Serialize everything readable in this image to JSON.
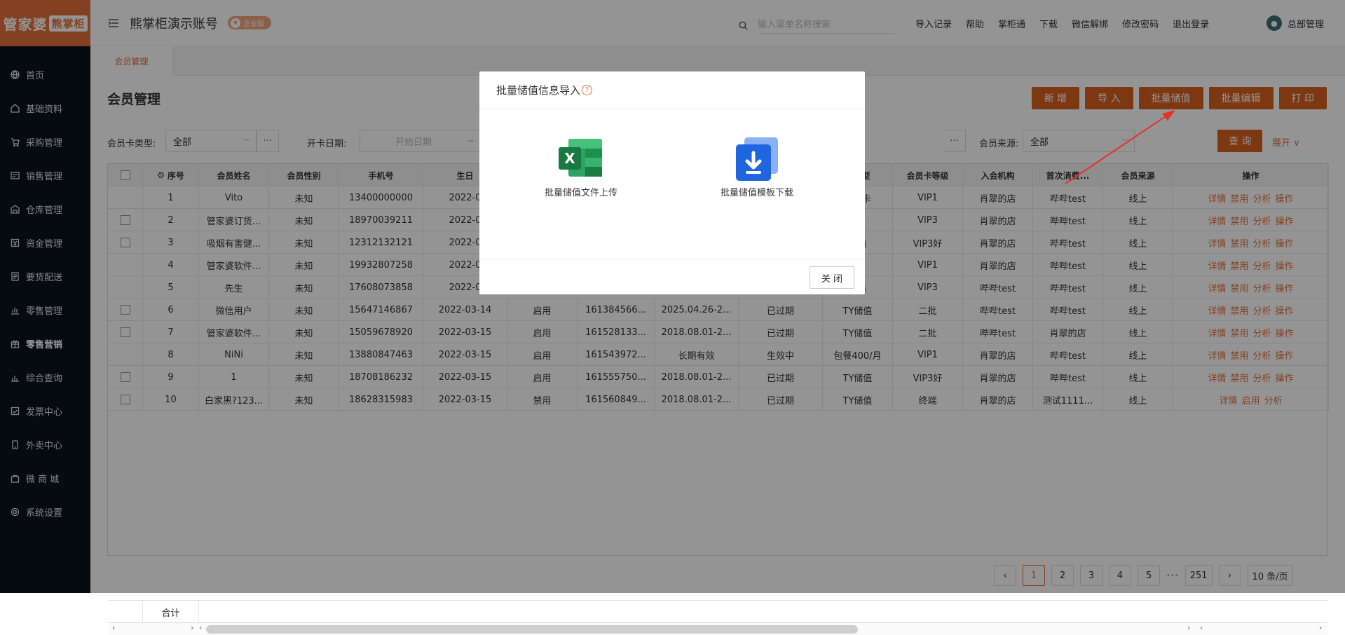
{
  "brand": {
    "logo_main": "管家婆",
    "logo_sub": "熊掌柜"
  },
  "sidebar": {
    "items": [
      {
        "label": "首页",
        "icon": "globe-icon"
      },
      {
        "label": "基础资料",
        "icon": "home-icon"
      },
      {
        "label": "采购管理",
        "icon": "cart-icon"
      },
      {
        "label": "销售管理",
        "icon": "sales-icon"
      },
      {
        "label": "仓库管理",
        "icon": "warehouse-icon"
      },
      {
        "label": "资金管理",
        "icon": "money-icon"
      },
      {
        "label": "要货配送",
        "icon": "document-icon"
      },
      {
        "label": "零售管理",
        "icon": "chart-icon"
      },
      {
        "label": "零售营销",
        "icon": "gift-icon"
      },
      {
        "label": "综合查询",
        "icon": "bar-chart-icon"
      },
      {
        "label": "发票中心",
        "icon": "invoice-icon"
      },
      {
        "label": "外卖中心",
        "icon": "delivery-icon"
      },
      {
        "label": "微 商 城",
        "icon": "shop-icon"
      },
      {
        "label": "系统设置",
        "icon": "gear-icon"
      }
    ]
  },
  "header": {
    "account": "熊掌柜演示账号",
    "edition": "企业版",
    "search_placeholder": "输入菜单名称搜索",
    "links": [
      "导入记录",
      "帮助",
      "掌柜通",
      "下载",
      "微信解绑",
      "修改密码",
      "退出登录"
    ],
    "user": "总部管理"
  },
  "tab": "会员管理",
  "page": {
    "title": "会员管理",
    "actions": [
      "新 增",
      "导 入",
      "批量储值",
      "批量编辑",
      "打 印"
    ]
  },
  "filters": {
    "card_type_label": "会员卡类型:",
    "card_type_value": "全部",
    "open_date_label": "开卡日期:",
    "date_start": "开始日期",
    "date_sep": "~",
    "source_label": "会员来源:",
    "source_value": "全部",
    "query": "查 询",
    "expand": "展开"
  },
  "table": {
    "headers": [
      "序号",
      "会员姓名",
      "会员性别",
      "手机号",
      "生日",
      "",
      "",
      "",
      "",
      "卡类型",
      "会员卡等级",
      "入会机构",
      "首次消费...",
      "会员来源",
      "操作"
    ],
    "rows": [
      {
        "cb": false,
        "cells": [
          "1",
          "Vito",
          "未知",
          "13400000000",
          "2022-0",
          "",
          "",
          "",
          "",
          "积分卡",
          "VIP1",
          "肖翠的店",
          "哔哔test",
          "线上"
        ],
        "ops": [
          "详情",
          "禁用",
          "分析",
          "操作"
        ]
      },
      {
        "cb": true,
        "cells": [
          "2",
          "管家婆订货...",
          "未知",
          "18970039211",
          "2022-0",
          "",
          "",
          "",
          "",
          "扣",
          "VIP3",
          "肖翠的店",
          "哔哔test",
          "线上"
        ],
        "ops": [
          "详情",
          "禁用",
          "分析",
          "操作"
        ]
      },
      {
        "cb": true,
        "cells": [
          "3",
          "吸烟有害健...",
          "未知",
          "12312132121",
          "2022-0",
          "",
          "",
          "",
          "",
          "储值",
          "VIP3好",
          "肖翠的店",
          "哔哔test",
          "线上"
        ],
        "ops": [
          "详情",
          "禁用",
          "分析",
          "操作"
        ]
      },
      {
        "cb": false,
        "cells": [
          "4",
          "管家婆软件...",
          "未知",
          "19932807258",
          "2022-0",
          "",
          "",
          "",
          "",
          "账",
          "VIP1",
          "肖翠的店",
          "哔哔test",
          "线上"
        ],
        "ops": [
          "详情",
          "禁用",
          "分析",
          "操作"
        ]
      },
      {
        "cb": false,
        "cells": [
          "5",
          "先生",
          "未知",
          "17608073858",
          "2022-0",
          "",
          "",
          "",
          "",
          "会员",
          "VIP3",
          "哔哔test",
          "哔哔test",
          "线上"
        ],
        "ops": [
          "详情",
          "禁用",
          "分析",
          "操作"
        ]
      },
      {
        "cb": true,
        "cells": [
          "6",
          "微信用户",
          "未知",
          "15647146867",
          "2022-03-14",
          "启用",
          "161384566...",
          "2025.04.26-2...",
          "已过期",
          "TY储值",
          "二批",
          "哔哔test",
          "哔哔test",
          "线上"
        ],
        "ops": [
          "详情",
          "禁用",
          "分析",
          "操作"
        ]
      },
      {
        "cb": true,
        "cells": [
          "7",
          "管家婆软件...",
          "未知",
          "15059678920",
          "2022-03-15",
          "启用",
          "161528133...",
          "2018.08.01-2...",
          "已过期",
          "TY储值",
          "二批",
          "哔哔test",
          "肖翠的店",
          "线上"
        ],
        "ops": [
          "详情",
          "禁用",
          "分析",
          "操作"
        ]
      },
      {
        "cb": false,
        "cells": [
          "8",
          "NiNi",
          "未知",
          "13880847463",
          "2022-03-15",
          "启用",
          "161543972...",
          "长期有效",
          "生效中",
          "包餐400/月",
          "VIP1",
          "肖翠的店",
          "哔哔test",
          "线上"
        ],
        "ops": [
          "详情",
          "禁用",
          "分析",
          "操作"
        ]
      },
      {
        "cb": true,
        "cells": [
          "9",
          "1",
          "未知",
          "18708186232",
          "2022-03-15",
          "启用",
          "161555750...",
          "2018.08.01-2...",
          "已过期",
          "TY储值",
          "VIP3好",
          "肖翠的店",
          "哔哔test",
          "线上"
        ],
        "ops": [
          "详情",
          "禁用",
          "分析",
          "操作"
        ]
      },
      {
        "cb": true,
        "cells": [
          "10",
          "白家黑?123...",
          "未知",
          "18628315983",
          "2022-03-15",
          "禁用",
          "161560849...",
          "2018.08.01-2...",
          "已过期",
          "TY储值",
          "终端",
          "肖翠的店",
          "测试1111...",
          "线上"
        ],
        "ops": [
          "详情",
          "启用",
          "分析"
        ]
      }
    ],
    "sum_label": "合计"
  },
  "pagination": {
    "pages": [
      "1",
      "2",
      "3",
      "4",
      "5"
    ],
    "ellipsis": "•••",
    "last": "251",
    "per_page": "10 条/页",
    "current": "1"
  },
  "modal": {
    "title": "批量储值信息导入",
    "help": "?",
    "options": [
      {
        "label": "批量储值文件上传",
        "icon": "excel-icon"
      },
      {
        "label": "批量储值模板下载",
        "icon": "download-icon"
      }
    ],
    "close": "关 闭"
  },
  "colors": {
    "accent": "#d75f1e",
    "sidebar_bg": "#0b1320",
    "excel": "#1f8f4e",
    "download": "#1f65e0"
  }
}
